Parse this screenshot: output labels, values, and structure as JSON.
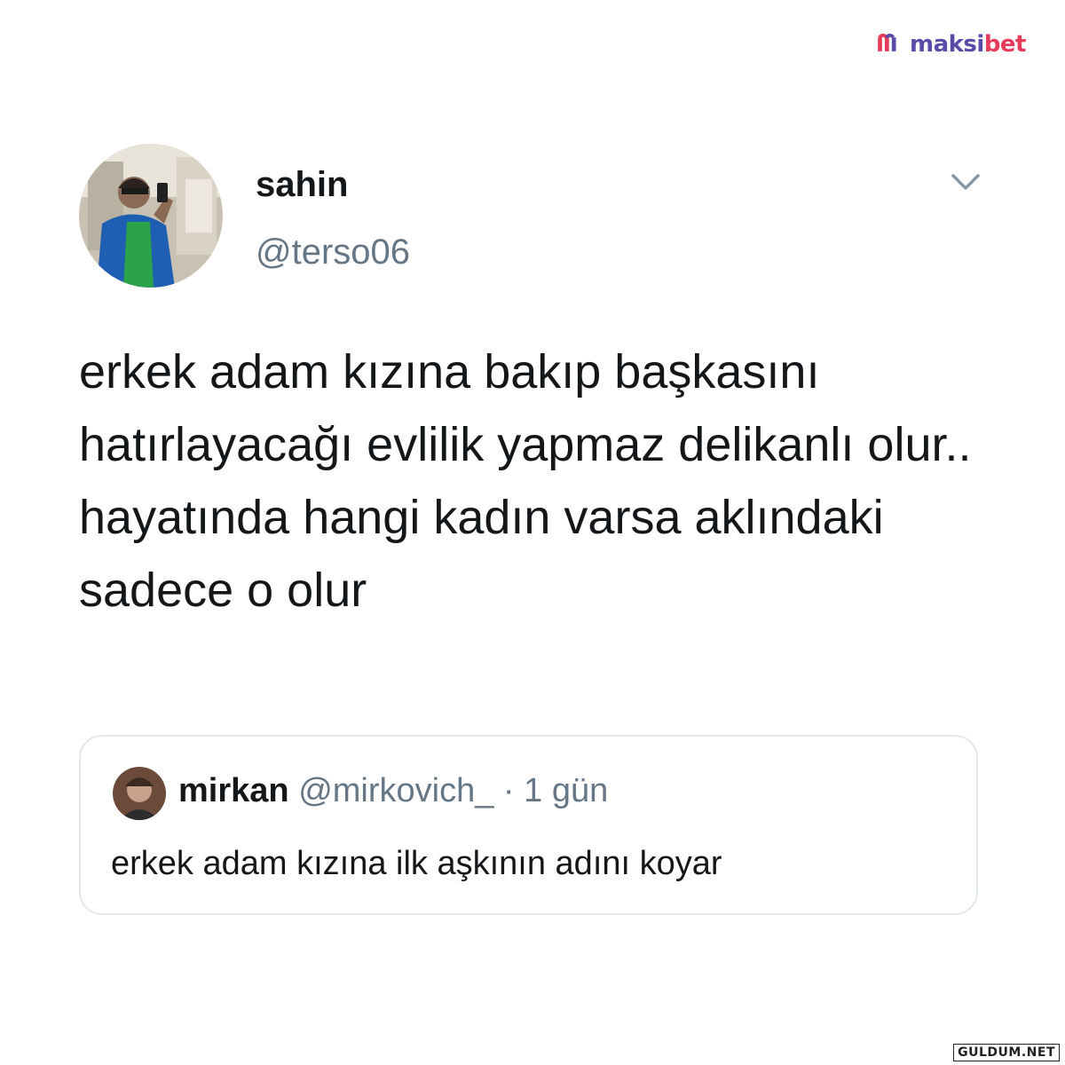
{
  "brand": {
    "logo_text_a": "maksi",
    "logo_text_b": "bet",
    "icon": "maksibet-logo-icon"
  },
  "tweet": {
    "author_name": "sahin",
    "author_handle": "@terso06",
    "menu_icon": "chevron-down-icon",
    "text": "erkek adam kızına bakıp başkasını hatırlayacağı evlilik yapmaz delikanlı olur.. hayatında hangi kadın varsa aklındaki sadece o olur"
  },
  "quoted_tweet": {
    "author_name": "mirkan",
    "author_handle": "@mirkovich_",
    "separator": "·",
    "time": "1 gün",
    "text": "erkek adam kızına ilk aşkının adını koyar"
  },
  "watermark": {
    "text": "GULDUM.NET"
  },
  "colors": {
    "text": "#14171a",
    "secondary": "#657786",
    "border": "#e1e8ed",
    "logo_purple": "#5b4ba8",
    "logo_red": "#e63b5a"
  }
}
